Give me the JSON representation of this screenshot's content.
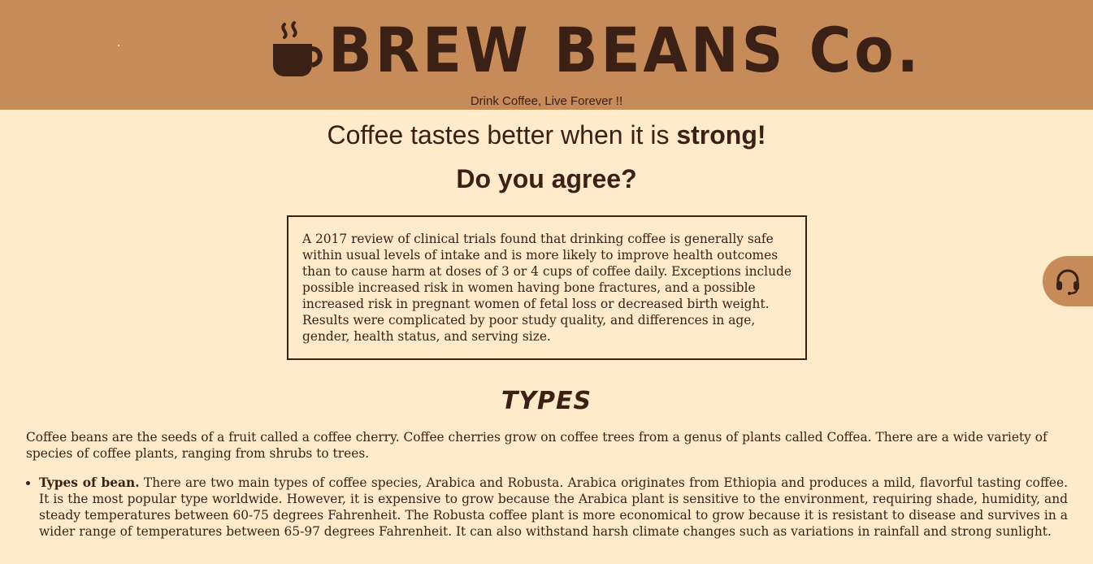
{
  "header": {
    "brand": "BREW BEANS Co.",
    "tagline": "Drink Coffee, Live Forever !!",
    "logo_icon": "coffee-cup-icon"
  },
  "hero": {
    "headline_prefix": "Coffee tastes better when it is ",
    "headline_strong": "strong!",
    "question": "Do you agree?"
  },
  "quote": "A 2017 review of clinical trials found that drinking coffee is generally safe within usual levels of intake and is more likely to improve health outcomes than to cause harm at doses of 3 or 4 cups of coffee daily. Exceptions include possible increased risk in women having bone fractures, and a possible increased risk in pregnant women of fetal loss or decreased birth weight. Results were complicated by poor study quality, and differences in age, gender, health status, and serving size.",
  "support": {
    "icon": "headset-icon"
  },
  "types": {
    "title": "TYPES",
    "intro": "Coffee beans are the seeds of a fruit called a coffee cherry. Coffee cherries grow on coffee trees from a genus of plants called Coffea. There are a wide variety of species of coffee plants, ranging from shrubs to trees.",
    "items": [
      {
        "label": "Types of bean.",
        "text": " There are two main types of coffee species, Arabica and Robusta. Arabica originates from Ethiopia and produces a mild, flavorful tasting coffee. It is the most popular type worldwide. However, it is expensive to grow because the Arabica plant is sensitive to the environment, requiring shade, humidity, and steady temperatures between 60-75 degrees Fahrenheit. The Robusta coffee plant is more economical to grow because it is resistant to disease and survives in a wider range of temperatures between 65-97 degrees Fahrenheit. It can also withstand harsh climate changes such as variations in rainfall and strong sunlight."
      }
    ]
  },
  "colors": {
    "header_bg": "#c68b59",
    "page_bg": "#ffebc9",
    "text": "#3b2016"
  }
}
